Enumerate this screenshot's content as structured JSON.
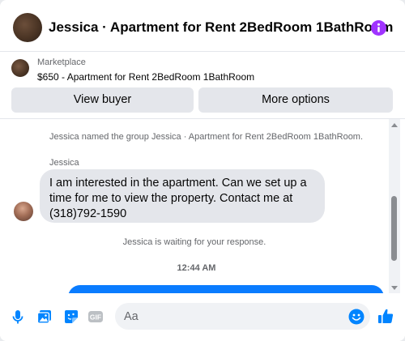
{
  "header": {
    "title": "Jessica · Apartment for Rent 2BedRoom 1BathRoom",
    "avatar_icon": "profile-photo",
    "info_icon": "info-icon",
    "accent": "#a033ff"
  },
  "listing": {
    "source": "Marketplace",
    "title": "$650 - Apartment for Rent 2BedRoom 1BathRoom"
  },
  "actions": {
    "view_buyer": "View buyer",
    "more_options": "More options"
  },
  "conversation": {
    "system_rename": "Jessica named the group Jessica · Apartment for Rent 2BedRoom 1BathRoom.",
    "sender_name": "Jessica",
    "message_text": "I am interested in the apartment. Can we set up a time for me to view the property. Contact me at (318)792-1590",
    "waiting_text": "Jessica is waiting for your response.",
    "timestamp": "12:44 AM"
  },
  "composer": {
    "placeholder": "Aa",
    "icons": [
      "microphone-icon",
      "photo-icon",
      "sticker-icon",
      "gif-icon",
      "emoji-icon",
      "like-icon"
    ],
    "gif_label": "GIF",
    "accent": "#0084ff"
  }
}
